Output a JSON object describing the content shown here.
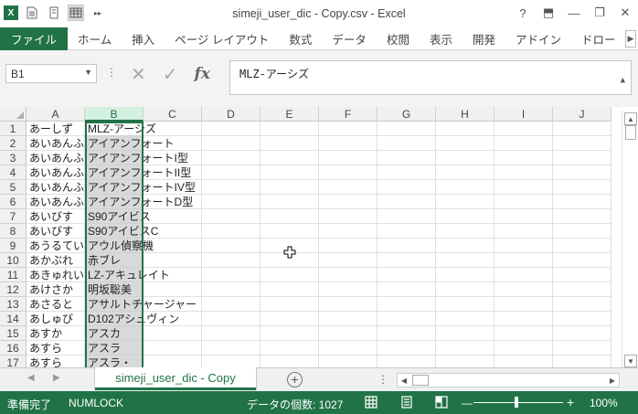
{
  "window": {
    "title": "simeji_user_dic - Copy.csv - Excel",
    "help": "?",
    "ribbon_display": "⬒",
    "minimize": "—",
    "restore": "❐",
    "close": "✕"
  },
  "qat": {
    "logo": "X",
    "more": "▸▸"
  },
  "ribbon": {
    "tabs": [
      "ファイル",
      "ホーム",
      "挿入",
      "ページ レイアウト",
      "数式",
      "データ",
      "校閲",
      "表示",
      "開発",
      "アドイン",
      "ドロー"
    ],
    "scroll_icon": "▶"
  },
  "formula_bar": {
    "name_box": "B1",
    "dropdown": "▼",
    "dots": "⋮",
    "cancel": "✕",
    "enter": "✓",
    "fx": "fx",
    "content": "MLZ-アーシズ",
    "expand": "▲"
  },
  "grid": {
    "columns": [
      "A",
      "B",
      "C",
      "D",
      "E",
      "F",
      "G",
      "H",
      "I",
      "J"
    ],
    "selected_column": "B",
    "rows": [
      {
        "n": "1",
        "a": "あーしず",
        "b": "MLZ-アーシズ"
      },
      {
        "n": "2",
        "a": "あいあんふぉーと",
        "b": "アイアンフォート"
      },
      {
        "n": "3",
        "a": "あいあんふぉーと",
        "b": "アイアンフォートI型"
      },
      {
        "n": "4",
        "a": "あいあんふぉーと",
        "b": "アイアンフォートII型"
      },
      {
        "n": "5",
        "a": "あいあんふぉーと",
        "b": "アイアンフォートIV型"
      },
      {
        "n": "6",
        "a": "あいあんふぉーと",
        "b": "アイアンフォートD型"
      },
      {
        "n": "7",
        "a": "あいびす",
        "b": "S90アイビス"
      },
      {
        "n": "8",
        "a": "あいびす",
        "b": "S90アイビスC"
      },
      {
        "n": "9",
        "a": "あうるてい",
        "b": "アウル偵察機"
      },
      {
        "n": "10",
        "a": "あかぶれ",
        "b": "赤ブレ"
      },
      {
        "n": "11",
        "a": "あきゅれい",
        "b": "LZ-アキュレイト"
      },
      {
        "n": "12",
        "a": "あけさか",
        "b": "明坂聡美"
      },
      {
        "n": "13",
        "a": "あさると",
        "b": "アサルトチャージャー"
      },
      {
        "n": "14",
        "a": "あしゅび",
        "b": "D102アシュヴィン"
      },
      {
        "n": "15",
        "a": "あすか",
        "b": "アスカ"
      },
      {
        "n": "16",
        "a": "あすら",
        "b": "アスラ"
      },
      {
        "n": "17",
        "a": "あすら",
        "b": "アスラ・"
      }
    ]
  },
  "scroll": {
    "up": "▲",
    "down": "▼",
    "left": "◀",
    "right": "▶"
  },
  "sheets": {
    "nav_prev": "◀",
    "nav_next": "▶",
    "active": "simeji_user_dic - Copy",
    "add": "+",
    "dots": "⋮"
  },
  "status": {
    "ready": "準備完了",
    "numlock": "NUMLOCK",
    "count_label": "データの個数: 1027",
    "zoom_minus": "—",
    "zoom_plus": "+",
    "zoom": "100%"
  },
  "colors": {
    "accent": "#217346",
    "selected_column_fill": "#d9d9d9"
  }
}
